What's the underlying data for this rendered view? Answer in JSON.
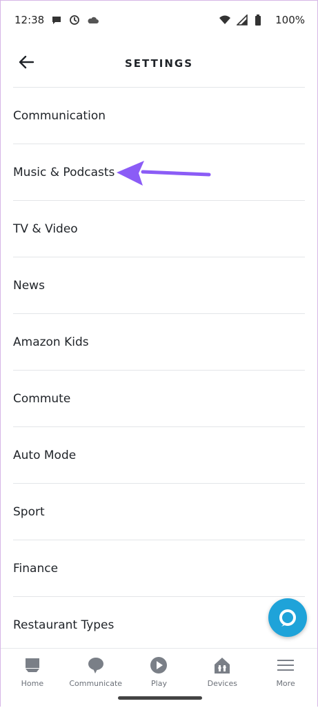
{
  "status_bar": {
    "time": "12:38",
    "notification_icons": [
      "chat-bubble-icon",
      "clock-icon",
      "cloud-icon"
    ],
    "system_icons": [
      "wifi-icon",
      "cellular-icon",
      "battery-icon"
    ],
    "battery_percent": "100%"
  },
  "header": {
    "title": "SETTINGS",
    "back_icon": "back-arrow-icon"
  },
  "settings": {
    "items": [
      {
        "label": "Communication"
      },
      {
        "label": "Music & Podcasts"
      },
      {
        "label": "TV & Video"
      },
      {
        "label": "News"
      },
      {
        "label": "Amazon Kids"
      },
      {
        "label": "Commute"
      },
      {
        "label": "Auto Mode"
      },
      {
        "label": "Sport"
      },
      {
        "label": "Finance"
      },
      {
        "label": "Restaurant Types"
      }
    ]
  },
  "annotation": {
    "color": "#8b5cf6",
    "points_to": "Music & Podcasts"
  },
  "alexa_button": {
    "icon": "alexa-ring-icon",
    "color": "#1fa3d9"
  },
  "bottom_nav": {
    "items": [
      {
        "label": "Home",
        "icon": "home-icon"
      },
      {
        "label": "Communicate",
        "icon": "speech-bubble-icon"
      },
      {
        "label": "Play",
        "icon": "play-icon"
      },
      {
        "label": "Devices",
        "icon": "devices-icon"
      },
      {
        "label": "More",
        "icon": "menu-icon"
      }
    ]
  }
}
